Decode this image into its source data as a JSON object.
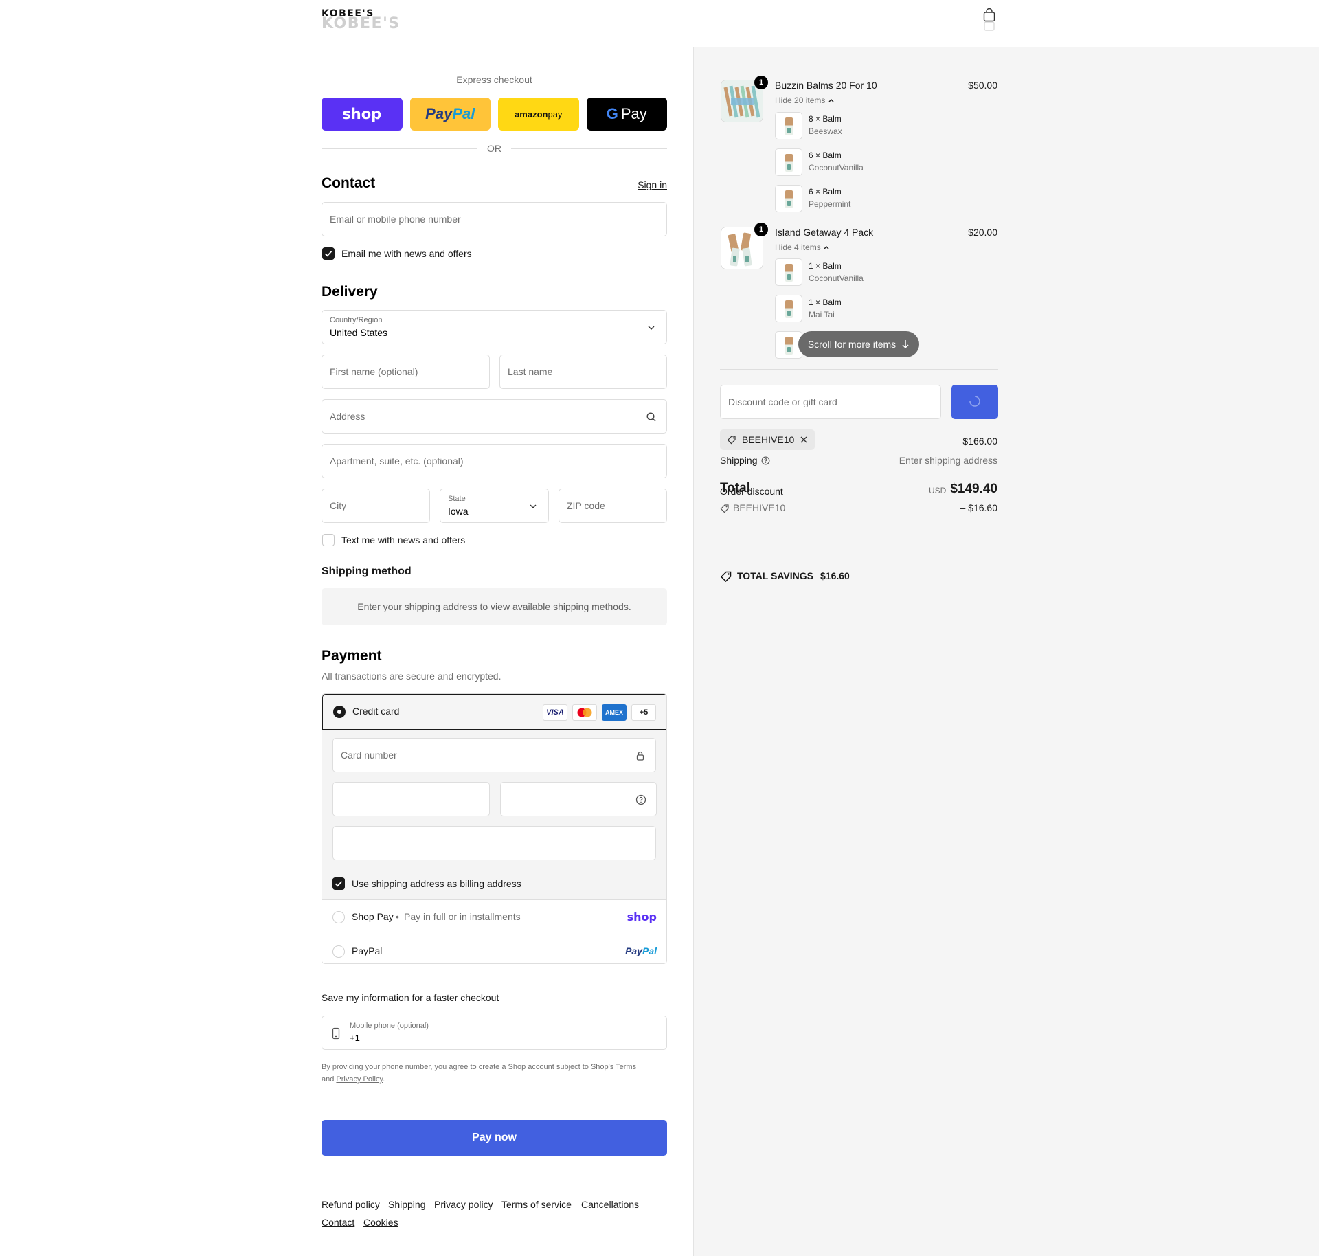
{
  "header": {
    "logo": "KOBEE'S",
    "cart_icon": "shopping-bag-icon"
  },
  "express": {
    "title": "Express checkout",
    "shop_label": "shop",
    "paypal_label_a": "Pay",
    "paypal_label_b": "Pal",
    "amazon_label_a": "amazon",
    "amazon_label_b": " pay",
    "gpay_label_g": "G",
    "gpay_label": "Pay",
    "or": "OR"
  },
  "contact": {
    "heading": "Contact",
    "sign_in": "Sign in",
    "email_placeholder": "Email or mobile phone number",
    "news_label": "Email me with news and offers",
    "news_checked": true
  },
  "delivery": {
    "heading": "Delivery",
    "country_label": "Country/Region",
    "country_value": "United States",
    "first_name_placeholder": "First name (optional)",
    "last_name_placeholder": "Last name",
    "address_placeholder": "Address",
    "apartment_placeholder": "Apartment, suite, etc. (optional)",
    "city_placeholder": "City",
    "state_label": "State",
    "state_value": "Iowa",
    "zip_placeholder": "ZIP code",
    "text_label": "Text me with news and offers",
    "text_checked": false
  },
  "shipping_method": {
    "heading": "Shipping method",
    "message": "Enter your shipping address to view available shipping methods."
  },
  "payment": {
    "heading": "Payment",
    "subtitle": "All transactions are secure and encrypted.",
    "credit_card_label": "Credit card",
    "brands": [
      "VISA",
      "MC",
      "AMEX",
      "+5"
    ],
    "card_number_placeholder": "Card number",
    "billing_label": "Use shipping address as billing address",
    "billing_checked": true,
    "shop_pay_label": "Shop Pay",
    "shop_pay_dot": "•",
    "shop_pay_sub": "Pay in full or in installments",
    "shop_pay_logo": "shop",
    "paypal_label": "PayPal",
    "paypal_logo_a": "Pay",
    "paypal_logo_b": "Pal"
  },
  "save_info": {
    "heading": "Save my information for a faster checkout",
    "phone_label": "Mobile phone (optional)",
    "phone_value": "+1",
    "legal_a": "By providing your phone number, you agree to create a Shop account subject to Shop's",
    "legal_terms": "Terms",
    "legal_b": "and",
    "legal_privacy": "Privacy Policy",
    "legal_c": "."
  },
  "pay_now": "Pay now",
  "footer": {
    "links": [
      "Refund policy",
      "Shipping",
      "Privacy policy",
      "Terms of service",
      "Cancellations",
      "Contact",
      "Cookies"
    ]
  },
  "summary": {
    "products": [
      {
        "name": "Buzzin Balms 20 For 10",
        "qty": "1",
        "price": "$50.00",
        "toggle": "Hide 20 items",
        "items": [
          {
            "qty": "8",
            "name": "Balm",
            "variant": "Beeswax"
          },
          {
            "qty": "6",
            "name": "Balm",
            "variant": "CoconutVanilla"
          },
          {
            "qty": "6",
            "name": "Balm",
            "variant": "Peppermint"
          }
        ]
      },
      {
        "name": "Island Getaway 4 Pack",
        "qty": "1",
        "price": "$20.00",
        "toggle": "Hide 4 items",
        "items": [
          {
            "qty": "1",
            "name": "Balm",
            "variant": "CoconutVanilla"
          },
          {
            "qty": "1",
            "name": "Balm",
            "variant": "Mai Tai"
          }
        ]
      }
    ],
    "times": "×",
    "scroll_pill": "Scroll for more items",
    "discount_placeholder": "Discount code or gift card",
    "applied_code": "BEEHIVE10",
    "subtotal_value": "$166.00",
    "shipping_label": "Shipping",
    "shipping_value": "Enter shipping address",
    "total_label": "Total",
    "order_discount_label": "Order discount",
    "currency": "USD",
    "total_value": "$149.40",
    "discount_code": "BEEHIVE10",
    "discount_value": "– $16.60",
    "savings_label": "TOTAL SAVINGS",
    "savings_value": "$16.60"
  },
  "colors": {
    "primary": "#4260e0",
    "shop_purple": "#5a31f4",
    "paypal_yellow": "#ffc439",
    "amazon_yellow": "#ffd814"
  }
}
